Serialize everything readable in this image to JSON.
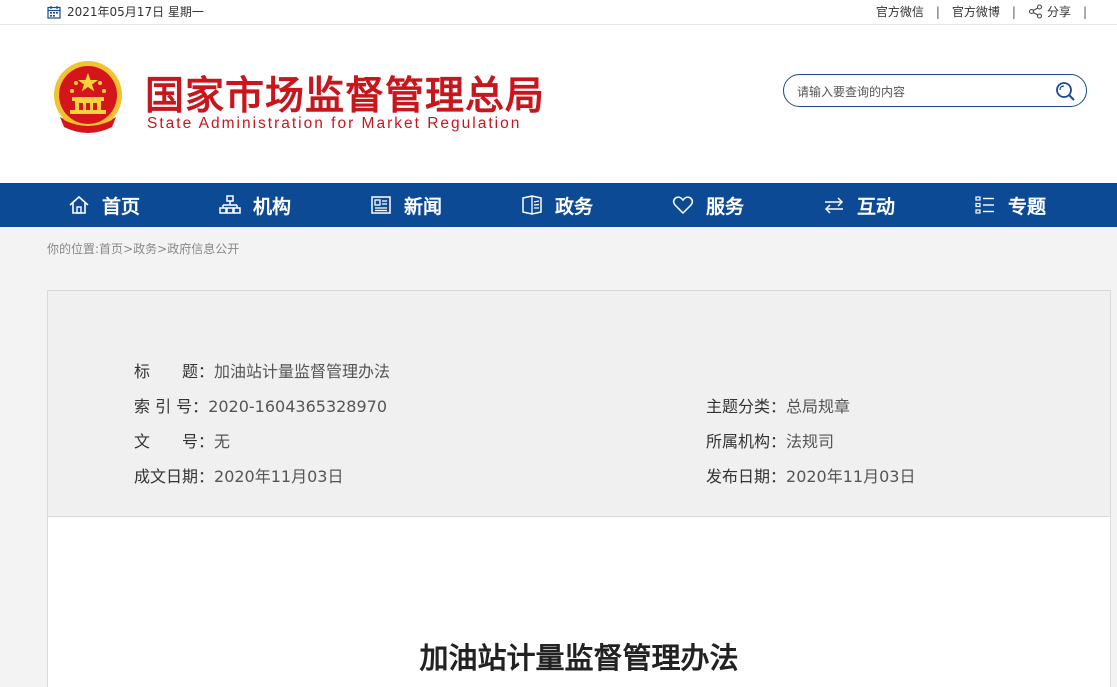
{
  "topbar": {
    "date": "2021年05月17日 星期一",
    "links": [
      "官方微信",
      "官方微博",
      "分享"
    ],
    "separator": "|"
  },
  "header": {
    "title_cn": "国家市场监督管理总局",
    "title_en": "State Administration for Market Regulation",
    "search_placeholder": "请输入要查询的内容"
  },
  "nav": [
    {
      "label": "首页",
      "icon": "home-icon"
    },
    {
      "label": "机构",
      "icon": "org-chart-icon"
    },
    {
      "label": "新闻",
      "icon": "news-icon"
    },
    {
      "label": "政务",
      "icon": "government-icon"
    },
    {
      "label": "服务",
      "icon": "heart-icon"
    },
    {
      "label": "互动",
      "icon": "exchange-arrows-icon"
    },
    {
      "label": "专题",
      "icon": "list-icon"
    }
  ],
  "breadcrumb": {
    "prefix": "你的位置:",
    "items": [
      "首页",
      "政务",
      "政府信息公开"
    ],
    "separator": ">"
  },
  "info": {
    "title_label": "标　　题：",
    "title_value": "加油站计量监督管理办法",
    "index_label": "索 引 号：",
    "index_value": "2020-1604365328970",
    "topic_label": "主题分类：",
    "topic_value": "总局规章",
    "doc_label": "文　　号：",
    "doc_value": "无",
    "org_label": "所属机构：",
    "org_value": "法规司",
    "created_label": "成文日期：",
    "created_value": "2020年11月03日",
    "published_label": "发布日期：",
    "published_value": "2020年11月03日"
  },
  "article": {
    "title": "加油站计量监督管理办法"
  },
  "colors": {
    "brand_red": "#c8161d",
    "nav_blue": "#0d4a95"
  }
}
